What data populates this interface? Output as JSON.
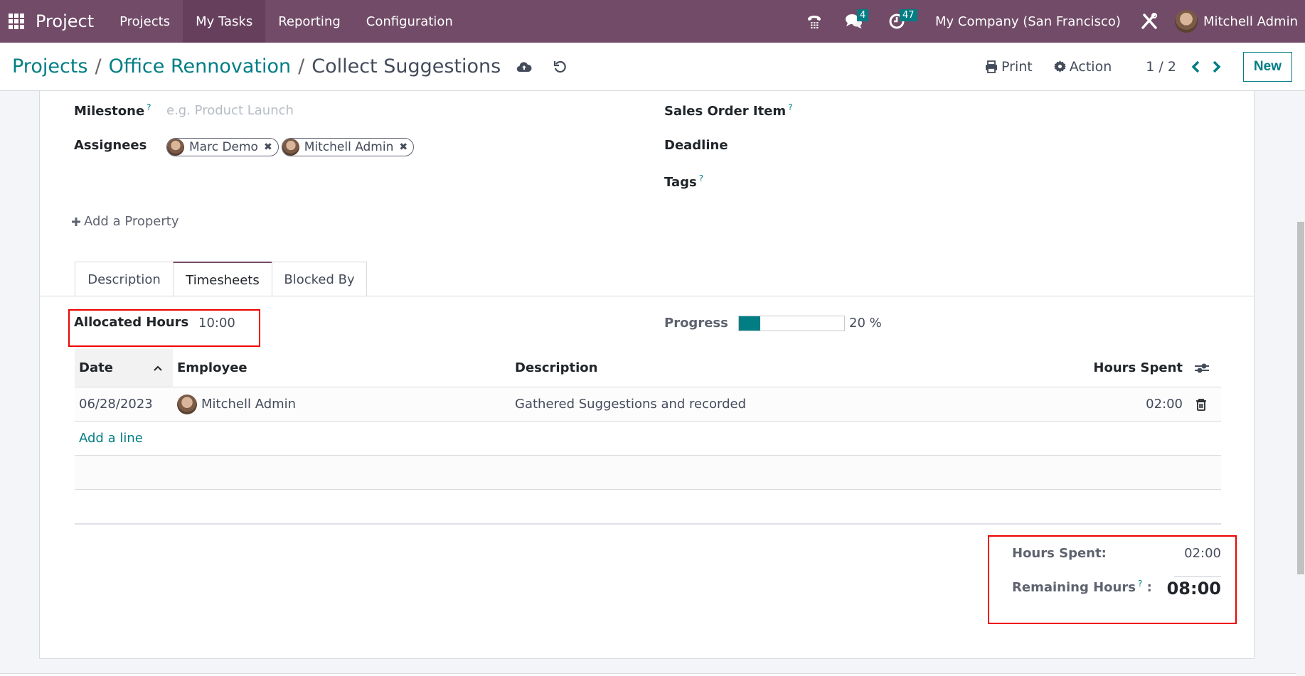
{
  "navbar": {
    "brand": "Project",
    "menu": [
      "Projects",
      "My Tasks",
      "Reporting",
      "Configuration"
    ],
    "active_menu": "My Tasks",
    "messages_count": "4",
    "activities_count": "47",
    "company": "My Company (San Francisco)",
    "user": "Mitchell Admin",
    "colors": {
      "primary": "#714b67",
      "accent": "#017e84"
    }
  },
  "control_panel": {
    "breadcrumb": [
      "Projects",
      "Office Rennovation",
      "Collect Suggestions"
    ],
    "print_label": "Print",
    "action_label": "Action",
    "pager": "1 / 2",
    "new_label": "New"
  },
  "form": {
    "milestone": {
      "label": "Milestone",
      "help": "?",
      "placeholder": "e.g. Product Launch"
    },
    "assignees": {
      "label": "Assignees",
      "tags": [
        "Marc Demo",
        "Mitchell Admin"
      ],
      "remove_icon": "✖"
    },
    "sales_order_item": {
      "label": "Sales Order Item",
      "help": "?"
    },
    "deadline": {
      "label": "Deadline"
    },
    "tags": {
      "label": "Tags",
      "help": "?"
    },
    "add_property": "Add a Property"
  },
  "tabs": [
    {
      "label": "Description",
      "active": false
    },
    {
      "label": "Timesheets",
      "active": true
    },
    {
      "label": "Blocked By",
      "active": false
    }
  ],
  "timesheets": {
    "allocated_hours_label": "Allocated Hours",
    "allocated_hours": "10:00",
    "progress_label": "Progress",
    "progress_percent": 20,
    "progress_text": "20 %",
    "columns": [
      "Date",
      "Employee",
      "Description",
      "Hours Spent"
    ],
    "rows": [
      {
        "date": "06/28/2023",
        "employee": "Mitchell Admin",
        "description": "Gathered Suggestions and recorded",
        "hours": "02:00"
      }
    ],
    "add_line": "Add a line",
    "totals": {
      "hours_spent_label": "Hours Spent:",
      "hours_spent": "02:00",
      "remaining_label": "Remaining Hours",
      "remaining_help": "?",
      "remaining_colon": ":",
      "remaining": "08:00"
    }
  }
}
